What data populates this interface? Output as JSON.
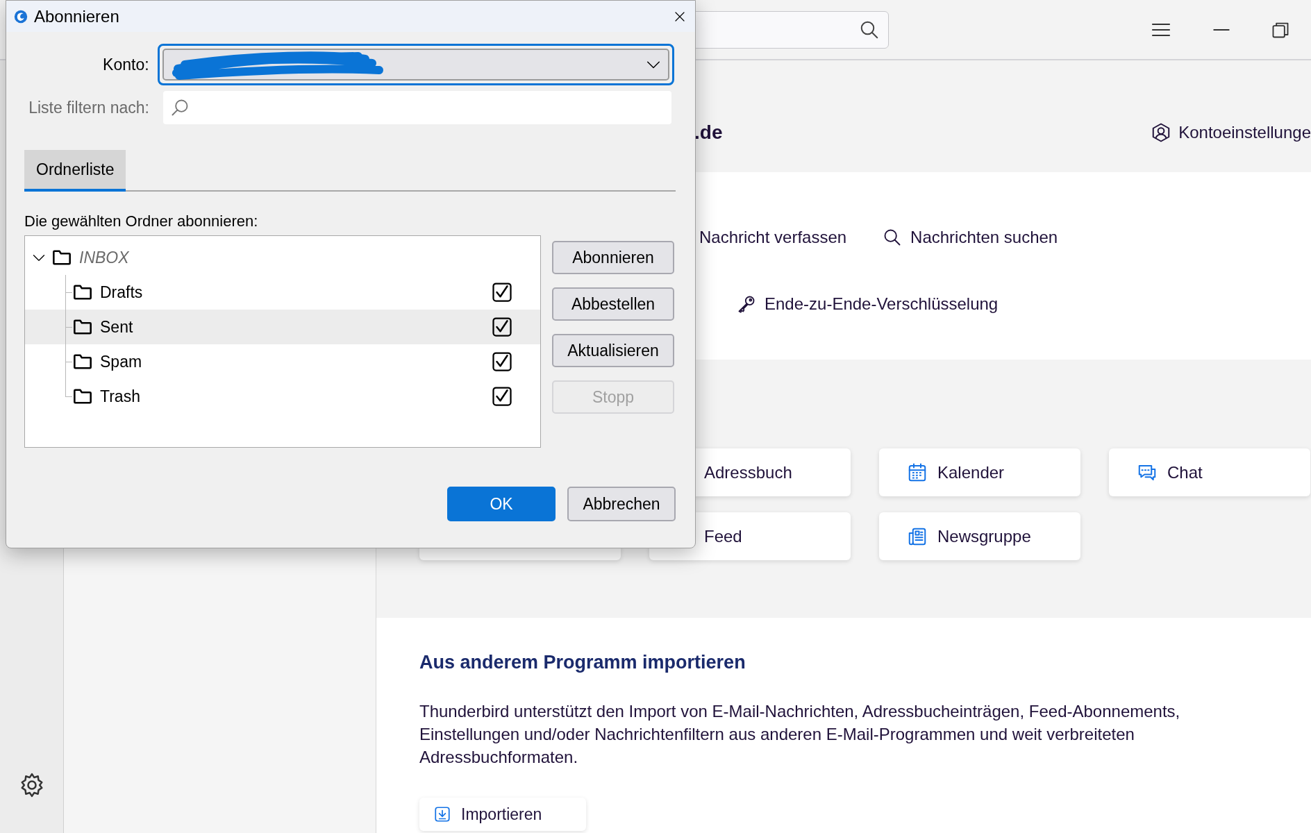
{
  "app": {
    "account_header": {
      "title": ".de",
      "settings_link": "Kontoeinstellunge"
    },
    "actions": [
      {
        "label": "Nachricht verfassen",
        "kind": "compose"
      },
      {
        "label": "Nachrichten suchen",
        "kind": "search"
      },
      {
        "label": "Ende-zu-Ende-Verschlüsselung",
        "kind": "key"
      }
    ],
    "setup_cards": [
      {
        "label": "Adressbuch",
        "kind": "addressbook"
      },
      {
        "label": "Kalender",
        "kind": "calendar"
      },
      {
        "label": "Chat",
        "kind": "chat"
      },
      {
        "kind": "blank"
      },
      {
        "label": "Feed",
        "kind": "feed"
      },
      {
        "label": "Newsgruppe",
        "kind": "news"
      }
    ],
    "import_section": {
      "title": "Aus anderem Programm importieren",
      "text": "Thunderbird unterstützt den Import von E-Mail-Nachrichten, Adressbucheinträgen, Feed-Abonnements, Einstellungen und/oder Nachrichtenfiltern aus anderen E-Mail-Programmen und weit verbreiteten Adressbuchformaten.",
      "button": "Importieren"
    }
  },
  "dialog": {
    "title": "Abonnieren",
    "account": {
      "label": "Konto:",
      "redacted": true
    },
    "filter": {
      "label": "Liste filtern nach:"
    },
    "tabs": [
      {
        "label": "Ordnerliste",
        "selected": true
      }
    ],
    "list_label": "Die gewählten Ordner abonnieren:",
    "folders": [
      {
        "name": "INBOX",
        "expanded": true,
        "selected": false,
        "children": [
          {
            "name": "Drafts",
            "checked": true,
            "selected": false
          },
          {
            "name": "Sent",
            "checked": true,
            "selected": true
          },
          {
            "name": "Spam",
            "checked": true,
            "selected": false
          },
          {
            "name": "Trash",
            "checked": true,
            "selected": false
          }
        ]
      }
    ],
    "side_buttons": [
      {
        "label": "Abonnieren",
        "disabled": false
      },
      {
        "label": "Abbestellen",
        "disabled": false
      },
      {
        "label": "Aktualisieren",
        "disabled": false
      },
      {
        "label": "Stopp",
        "disabled": true
      }
    ],
    "buttons": [
      {
        "label": "OK",
        "kind": "primary"
      },
      {
        "label": "Abbrechen",
        "kind": "secondary"
      }
    ]
  }
}
